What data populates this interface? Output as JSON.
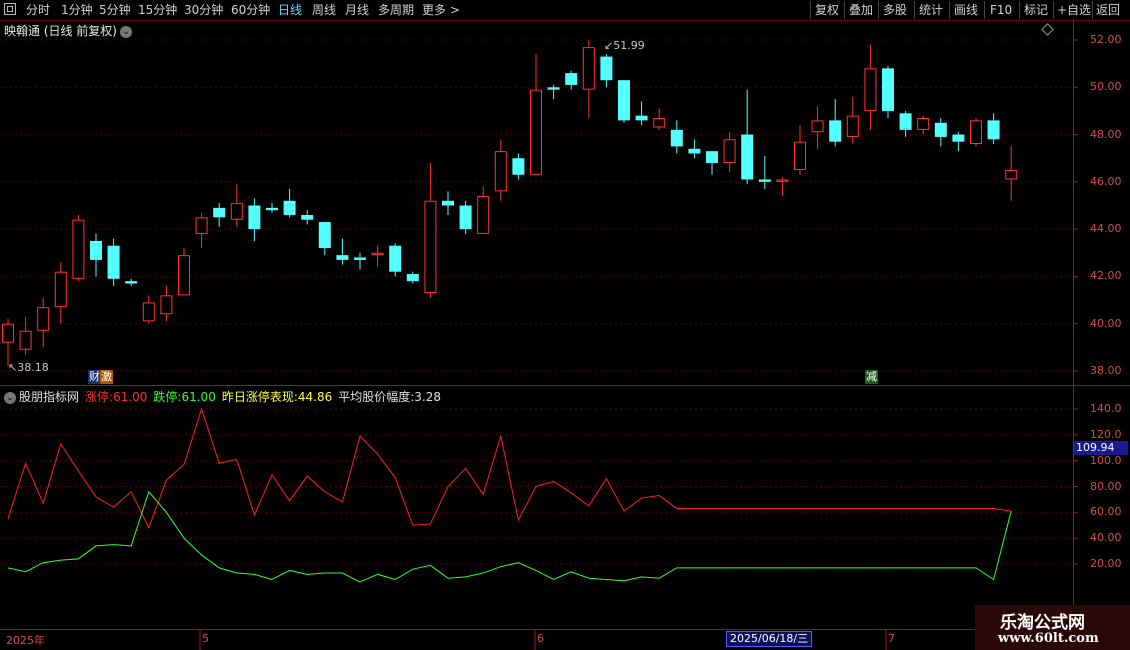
{
  "toolbar": {
    "periods": [
      "分时",
      "1分钟",
      "5分钟",
      "15分钟",
      "30分钟",
      "60分钟",
      "日线",
      "周线",
      "月线",
      "多周期",
      "更多 >"
    ],
    "active_period": "日线",
    "right": [
      "复权",
      "叠加",
      "多股",
      "统计",
      "画线",
      "F10",
      "标记",
      "+自选",
      "返回"
    ]
  },
  "stock": {
    "title": "映翰通 (日线 前复权)"
  },
  "price_axis": {
    "ticks": [
      "52.00",
      "50.00",
      "48.00",
      "46.00",
      "44.00",
      "42.00",
      "40.00",
      "38.00"
    ],
    "min": 37.6,
    "max": 52.4
  },
  "indicator": {
    "name": "股朋指标网",
    "zt_label": "涨停:",
    "zt_value": "61.00",
    "dt_label": "跌停:",
    "dt_value": "61.00",
    "yzt_label": "昨日涨停表现:",
    "yzt_value": "44.86",
    "avg_label": "平均股价幅度:",
    "avg_value": "3.28",
    "axis_ticks": [
      "140.0",
      "120.0",
      "100.0",
      "80.00",
      "60.00",
      "40.00",
      "20.00"
    ],
    "current_tag": "109.94",
    "min": 5,
    "max": 150
  },
  "high_label": "51.99",
  "low_label": "38.18",
  "markers": {
    "cai": "财",
    "ji": "激",
    "jian": "减"
  },
  "x_axis": {
    "year": "2025年",
    "m5": "5",
    "m6": "6",
    "m7": "7",
    "selected_date": "2025/06/18/三"
  },
  "watermark": {
    "line1": "乐淘公式网",
    "line2": "www.60lt.com"
  },
  "colors": {
    "up": "#ff3232",
    "down": "#54ffff",
    "grid": "#5a0000",
    "green": "#32ff32",
    "red_line": "#ff2020"
  },
  "chart_data": {
    "type": "candlestick",
    "candles": [
      [
        39.2,
        40.0,
        38.2,
        40.2
      ],
      [
        38.9,
        39.7,
        38.7,
        40.3
      ],
      [
        39.7,
        40.7,
        39.0,
        41.1
      ],
      [
        40.7,
        42.2,
        40.0,
        42.6
      ],
      [
        41.9,
        44.4,
        41.8,
        44.6
      ],
      [
        43.5,
        42.7,
        42.0,
        43.8
      ],
      [
        43.3,
        41.9,
        41.6,
        43.6
      ],
      [
        41.8,
        41.7,
        41.6,
        41.9
      ],
      [
        40.1,
        40.9,
        40.0,
        41.2
      ],
      [
        40.4,
        41.2,
        40.1,
        41.6
      ],
      [
        41.2,
        42.9,
        41.2,
        43.2
      ],
      [
        43.8,
        44.5,
        43.2,
        44.7
      ],
      [
        44.9,
        44.5,
        44.1,
        45.1
      ],
      [
        44.4,
        45.1,
        44.1,
        45.9
      ],
      [
        45.0,
        44.0,
        43.5,
        45.3
      ],
      [
        44.9,
        44.8,
        44.7,
        45.1
      ],
      [
        45.2,
        44.6,
        44.5,
        45.7
      ],
      [
        44.6,
        44.4,
        44.2,
        44.8
      ],
      [
        44.3,
        43.2,
        42.9,
        44.3
      ],
      [
        42.9,
        42.7,
        42.5,
        43.6
      ],
      [
        42.8,
        42.7,
        42.3,
        43.0
      ],
      [
        42.9,
        43.0,
        42.4,
        43.3
      ],
      [
        43.3,
        42.2,
        42.0,
        43.4
      ],
      [
        42.1,
        41.8,
        41.7,
        42.2
      ],
      [
        41.3,
        45.2,
        41.1,
        46.8
      ],
      [
        45.2,
        45.0,
        44.6,
        45.6
      ],
      [
        45.0,
        44.0,
        43.8,
        45.2
      ],
      [
        43.8,
        45.4,
        43.8,
        45.8
      ],
      [
        45.6,
        47.3,
        45.2,
        47.8
      ],
      [
        47.0,
        46.3,
        46.1,
        47.2
      ],
      [
        46.3,
        49.9,
        46.3,
        51.4
      ],
      [
        50.0,
        49.9,
        49.5,
        50.1
      ],
      [
        50.6,
        50.1,
        49.9,
        50.7
      ],
      [
        49.9,
        51.7,
        48.7,
        52.0
      ],
      [
        51.3,
        50.3,
        50.0,
        51.4
      ],
      [
        50.3,
        48.6,
        48.5,
        50.3
      ],
      [
        48.8,
        48.6,
        48.4,
        49.4
      ],
      [
        48.3,
        48.7,
        48.2,
        49.1
      ],
      [
        48.2,
        47.5,
        47.2,
        48.6
      ],
      [
        47.4,
        47.2,
        47.0,
        47.8
      ],
      [
        47.3,
        46.8,
        46.3,
        47.3
      ],
      [
        46.8,
        47.8,
        46.4,
        48.1
      ],
      [
        48.0,
        46.1,
        45.9,
        49.9
      ],
      [
        46.1,
        46.0,
        45.7,
        47.1
      ],
      [
        46.0,
        46.1,
        45.4,
        46.2
      ],
      [
        46.5,
        47.7,
        46.3,
        48.4
      ],
      [
        48.1,
        48.6,
        47.4,
        49.2
      ],
      [
        48.6,
        47.7,
        47.5,
        49.5
      ],
      [
        47.9,
        48.8,
        47.6,
        49.6
      ],
      [
        49.0,
        50.8,
        48.2,
        51.8
      ],
      [
        50.8,
        49.0,
        48.7,
        50.9
      ],
      [
        48.9,
        48.2,
        47.9,
        49.0
      ],
      [
        48.2,
        48.7,
        48.0,
        48.8
      ],
      [
        48.5,
        47.9,
        47.5,
        48.7
      ],
      [
        48.0,
        47.7,
        47.3,
        48.1
      ],
      [
        47.6,
        48.6,
        47.5,
        48.7
      ],
      [
        48.6,
        47.8,
        47.6,
        48.9
      ],
      [
        46.1,
        46.5,
        45.2,
        47.5
      ]
    ],
    "red_series": [
      55,
      98,
      67,
      113,
      92,
      72,
      64,
      76,
      48,
      85,
      97,
      140,
      98,
      101,
      58,
      89,
      69,
      88,
      76,
      68,
      119,
      105,
      87,
      50,
      51,
      80,
      94,
      74,
      119,
      54,
      80,
      84,
      75,
      65,
      86,
      61,
      71,
      73,
      63,
      63,
      63,
      63,
      63,
      63,
      63,
      63,
      63,
      63,
      63,
      63,
      63,
      63,
      63,
      63,
      63,
      63,
      63,
      61
    ],
    "green_series": [
      17,
      14,
      21,
      23,
      24,
      34,
      35,
      34,
      76,
      60,
      40,
      27,
      17,
      13,
      12,
      8,
      15,
      12,
      13,
      13,
      6,
      12,
      8,
      16,
      19,
      9,
      10,
      13,
      18,
      21,
      15,
      8,
      14,
      9,
      8,
      7,
      10,
      9,
      17,
      17,
      17,
      17,
      17,
      17,
      17,
      17,
      17,
      17,
      17,
      17,
      17,
      17,
      17,
      17,
      17,
      17,
      8,
      61
    ]
  }
}
